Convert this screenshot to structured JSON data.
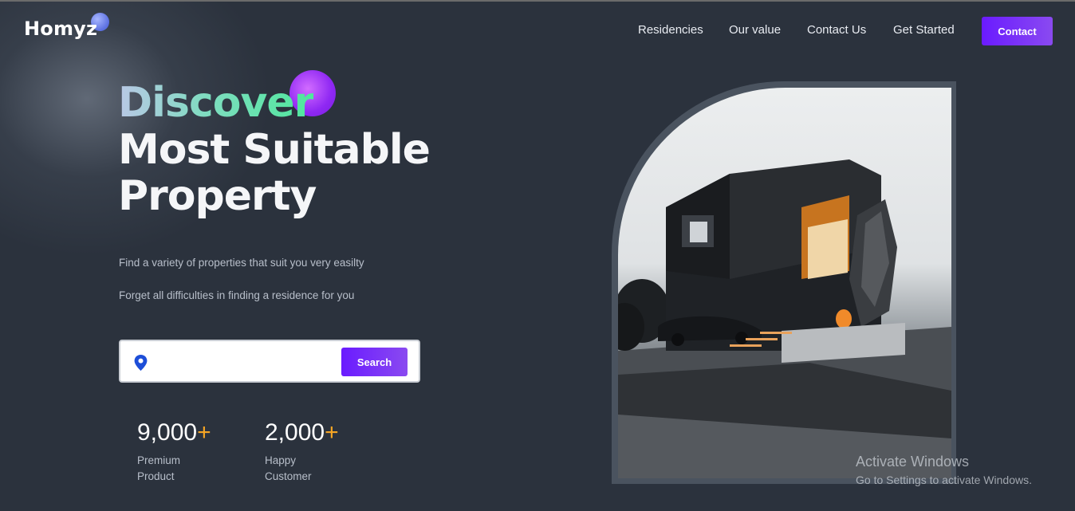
{
  "header": {
    "logo": "Homyz",
    "nav": [
      {
        "label": "Residencies"
      },
      {
        "label": "Our value"
      },
      {
        "label": "Contact Us"
      },
      {
        "label": "Get Started"
      }
    ],
    "contact_button": "Contact"
  },
  "hero": {
    "title_line1": "Discover",
    "title_line2": "Most Suitable",
    "title_line3": "Property",
    "description_1": "Find a variety of properties that suit you very easilty",
    "description_2": "Forget all difficulties in finding a residence for you",
    "search": {
      "value": "",
      "icon": "location-pin-icon",
      "button_label": "Search"
    },
    "stats": [
      {
        "value": "9,000",
        "suffix": "+",
        "label_line1": "Premium",
        "label_line2": "Product"
      },
      {
        "value": "2,000",
        "suffix": "+",
        "label_line1": "Happy",
        "label_line2": "Customer"
      }
    ]
  },
  "watermark": {
    "line1": "Activate Windows",
    "line2": "Go to Settings to activate Windows."
  },
  "colors": {
    "background": "#2b323d",
    "accent": "#6a1bff",
    "plus": "#f5a524",
    "pin": "#1d4ed8"
  }
}
